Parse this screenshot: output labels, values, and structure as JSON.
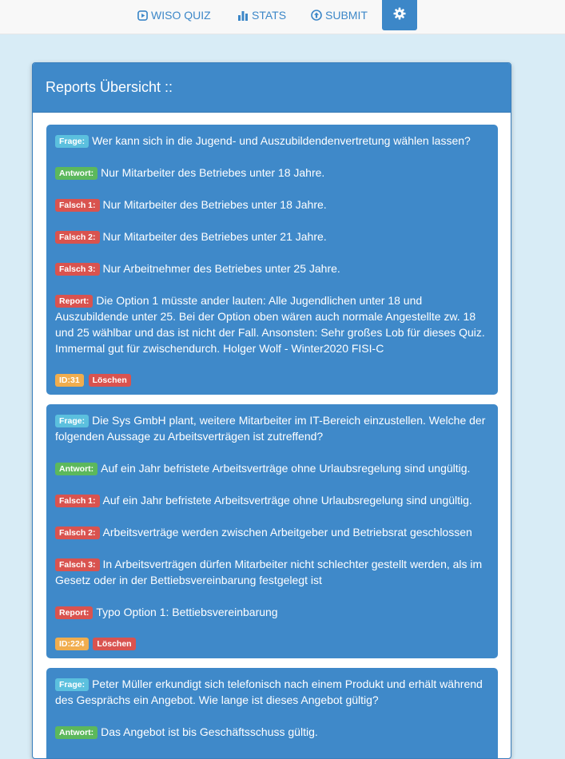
{
  "nav": {
    "wiso_label": "WISO QUIZ",
    "stats_label": "STATS",
    "submit_label": "SUBMIT"
  },
  "panel": {
    "title": "Reports Übersicht ::"
  },
  "labels": {
    "frage": "Frage:",
    "antwort": "Antwort:",
    "falsch1": "Falsch 1:",
    "falsch2": "Falsch 2:",
    "falsch3": "Falsch 3:",
    "report": "Report:",
    "delete": "Löschen"
  },
  "reports": [
    {
      "frage": "Wer kann sich in die Jugend- und Auszubildendenvertretung wählen lassen?",
      "antwort": "Nur Mitarbeiter des Betriebes unter 18 Jahre.",
      "falsch1": "Nur Mitarbeiter des Betriebes unter 18 Jahre.",
      "falsch2": "Nur Mitarbeiter des Betriebes unter 21 Jahre.",
      "falsch3": "Nur Arbeitnehmer des Betriebes unter 25 Jahre.",
      "report": "Die Option 1 müsste ander lauten: Alle Jugendlichen unter 18 und Auszubildende unter 25. Bei der Option oben wären auch normale Angestellte zw. 18 und 25 wählbar und das ist nicht der Fall. Ansonsten: Sehr großes Lob für dieses Quiz. Immermal gut für zwischendurch. Holger Wolf - Winter2020 FISI-C",
      "id": "ID:31"
    },
    {
      "frage": "Die Sys GmbH plant, weitere Mitarbeiter im IT-Bereich einzustellen. Welche der folgenden Aussage zu Arbeitsverträgen ist zutreffend?",
      "antwort": "Auf ein Jahr befristete Arbeitsverträge ohne Urlaubsregelung sind ungültig.",
      "falsch1": "Auf ein Jahr befristete Arbeitsverträge ohne Urlaubsregelung sind ungültig.",
      "falsch2": "Arbeitsverträge werden zwischen Arbeitgeber und Betriebsrat geschlossen",
      "falsch3": "In Arbeitsverträgen dürfen Mitarbeiter nicht schlechter gestellt werden, als im Gesetz oder in der Bettiebsvereinbarung festgelegt ist",
      "report": "Typo Option 1: Bettiebsvereinbarung",
      "id": "ID:224"
    },
    {
      "frage": "Peter Müller erkundigt sich telefonisch nach einem Produkt und erhält während des Gesprächs ein Angebot. Wie lange ist dieses Angebot gültig?",
      "antwort": "Das Angebot ist bis Geschäftsschuss gültig."
    }
  ]
}
